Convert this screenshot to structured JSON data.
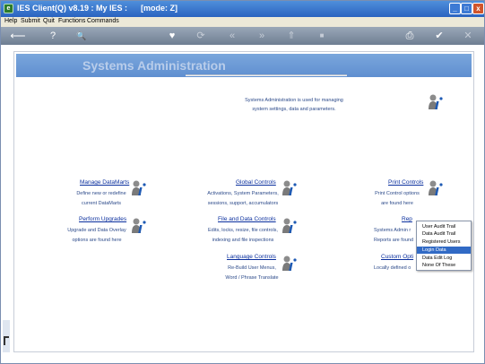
{
  "window": {
    "title": "IES Client(Q) v8.19 : My IES :      [mode: Z]",
    "app_icon": "ies-logo-icon",
    "controls": {
      "minimize_glyph": "_",
      "maximize_glyph": "□",
      "close_glyph": "x"
    }
  },
  "menu": {
    "items": [
      "Help",
      "Submit",
      "Quit",
      "Functions",
      "Commands"
    ]
  },
  "toolbar": {
    "icons": [
      "back-arrow-icon",
      "help-icon",
      "search-icon",
      "heart-icon",
      "refresh-icon",
      "rewind-icon",
      "fast-forward-icon",
      "up-icon",
      "stop-icon",
      "print-icon",
      "ok-icon",
      "cancel-icon"
    ],
    "glyphs": {
      "back": "⟵",
      "help": "?",
      "search": "🔍",
      "heart": "♥",
      "refresh": "⟳",
      "rewind": "«",
      "forward": "»",
      "up": "⇑",
      "stop": "■",
      "print": "⎙",
      "ok": "✔",
      "cancel": "✕"
    }
  },
  "page": {
    "banner_title": "Systems Administration",
    "intro_line1": "Systems Administration is used for managing",
    "intro_line2": "system settings, data and parameters."
  },
  "sections": {
    "manage_datamarts": {
      "title": "Manage DataMarts",
      "line1": "Define new or redefine",
      "line2": "current DataMarts"
    },
    "global_controls": {
      "title": "Global Controls",
      "line1": "Activations, System Parameters,",
      "line2": "sessions, support, accumulators"
    },
    "print_controls": {
      "title": "Print Controls",
      "line1": "Print Control options",
      "line2": "are found here"
    },
    "perform_upgrades": {
      "title": "Perform Upgrades",
      "line1": "Upgrade and Data Overlay",
      "line2": "options are found here"
    },
    "file_data_controls": {
      "title": "File and Data Controls",
      "line1": "Edits, locks, resize, file controls,",
      "line2": "indexing and file inspections"
    },
    "reports": {
      "title": "Rep",
      "line1": "Systems Admin r",
      "line2": "Reports are found"
    },
    "language_controls": {
      "title": "Language Controls",
      "line1": "Re-Build User Menus,",
      "line2": "Word / Phrase Translate"
    },
    "custom_options": {
      "title": "Custom Opti",
      "line1": "Locally defined o"
    }
  },
  "popup": {
    "items": [
      "User Audit Trail",
      "Data Audit Trail",
      "Registered Users",
      "Login Data",
      "Data Edit Log",
      "None Of These"
    ],
    "selected_index": 3
  },
  "colors": {
    "title_bar": "#2a63c0",
    "banner": "#6a98d6",
    "link": "#0a2f9e",
    "description": "#2c4a8a",
    "selection": "#316ac5"
  }
}
